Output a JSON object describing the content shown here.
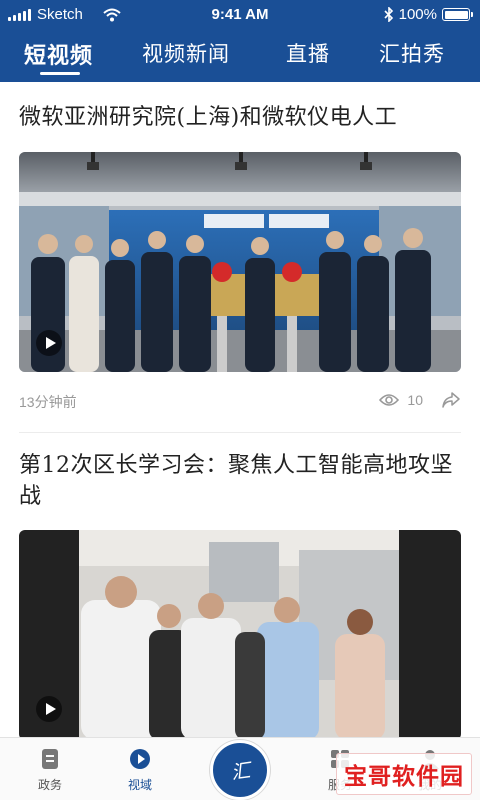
{
  "status_bar": {
    "carrier": "Sketch",
    "time": "9:41 AM",
    "battery": "100%"
  },
  "tabs": [
    {
      "label": "短视频",
      "active": true
    },
    {
      "label": "视频新闻",
      "active": false
    },
    {
      "label": "直播",
      "active": false
    },
    {
      "label": "汇拍秀",
      "active": false
    }
  ],
  "feed": [
    {
      "title": "微软亚洲研究院(上海)和微软仪电人工",
      "time_ago": "13分钟前",
      "views": "10"
    },
    {
      "title": "第12次区长学习会：聚焦人工智能高地攻坚战"
    }
  ],
  "bottom_nav": {
    "items": [
      {
        "label": "政务",
        "icon": "document-icon"
      },
      {
        "label": "视域",
        "icon": "play-circle-icon",
        "active": true
      },
      {
        "label": "服务",
        "icon": "grid-icon"
      },
      {
        "label": "我的",
        "icon": "person-icon"
      }
    ],
    "center_logo": "汇"
  },
  "watermark": {
    "text": "宝哥软件园"
  },
  "colors": {
    "brand": "#1a4f96",
    "meta_text": "#999999",
    "watermark": "#e02020"
  }
}
